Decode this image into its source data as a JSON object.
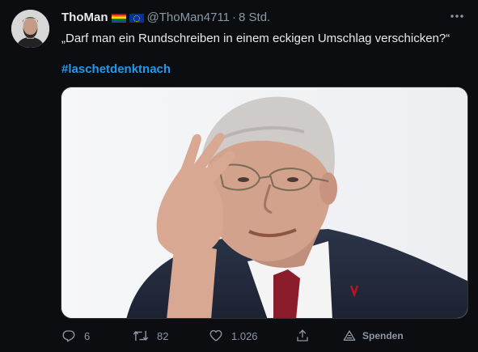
{
  "author": {
    "display_name": "ThoMan",
    "handle": "@ThoMan4711",
    "separator": "·",
    "time": "8 Std.",
    "badges": [
      "rainbow-flag-icon",
      "eu-flag-icon"
    ]
  },
  "tweet": {
    "text": "„Darf man ein Rundschreiben in einem eckigen Umschlag verschicken?“",
    "hashtag": "#laschetdenktnach"
  },
  "actions": {
    "reply_count": "6",
    "retweet_count": "82",
    "like_count": "1.026",
    "donate_label": "Spenden"
  },
  "icons": [
    "more-icon",
    "reply-icon",
    "retweet-icon",
    "like-icon",
    "share-icon",
    "donate-icon"
  ],
  "colors": {
    "background": "#0b0d10",
    "text": "#e7e9ea",
    "muted": "#8b98a5",
    "link": "#1d9bf0"
  }
}
